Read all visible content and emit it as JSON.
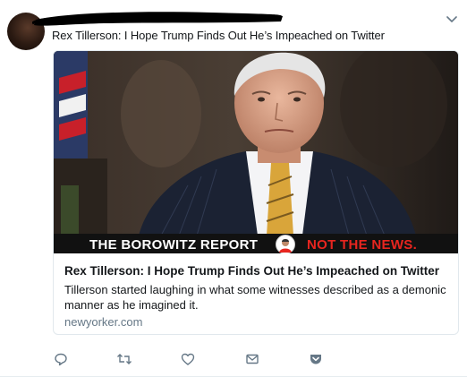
{
  "tweet": {
    "text": "Rex Tillerson: I Hope Trump Finds Out He’s Impeached on Twitter"
  },
  "card": {
    "banner_left": "THE BOROWITZ REPORT",
    "banner_right": "NOT THE NEWS.",
    "title": "Rex Tillerson: I Hope Trump Finds Out He’s Impeached on Twitter",
    "description": "Tillerson started laughing in what some witnesses described as a demonic manner as he imagined it.",
    "domain": "newyorker.com"
  },
  "actions": [
    {
      "name": "reply",
      "icon": "reply-icon"
    },
    {
      "name": "retweet",
      "icon": "retweet-icon"
    },
    {
      "name": "like",
      "icon": "heart-icon"
    },
    {
      "name": "message",
      "icon": "envelope-icon"
    },
    {
      "name": "pocket",
      "icon": "pocket-icon"
    }
  ],
  "colors": {
    "icon": "#657786",
    "pocket": "#657786",
    "banner_red": "#e8251f"
  }
}
